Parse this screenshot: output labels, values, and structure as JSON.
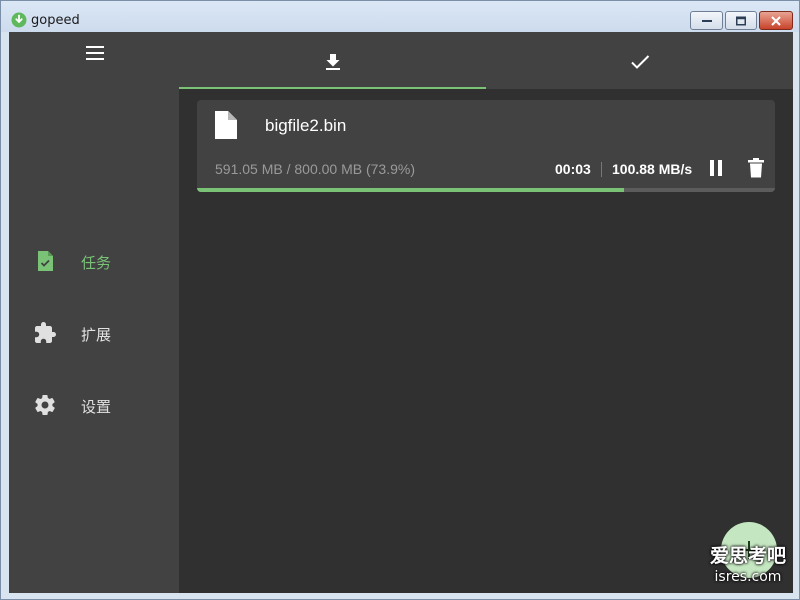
{
  "window": {
    "title": "gopeed",
    "controls": {
      "minimize": "minimize-icon",
      "maximize": "maximize-icon",
      "close": "close-icon"
    }
  },
  "sidebar": {
    "menu_icon": "menu-icon",
    "items": [
      {
        "id": "tasks",
        "label": "任务",
        "icon": "task-file-icon",
        "active": true
      },
      {
        "id": "extensions",
        "label": "扩展",
        "icon": "puzzle-icon",
        "active": false
      },
      {
        "id": "settings",
        "label": "设置",
        "icon": "gear-icon",
        "active": false
      }
    ]
  },
  "tabs": [
    {
      "id": "downloading",
      "icon": "download-icon",
      "active": true
    },
    {
      "id": "done",
      "icon": "check-icon",
      "active": false
    }
  ],
  "tasks": [
    {
      "file_name": "bigfile2.bin",
      "progress_text": "591.05 MB / 800.00 MB (73.9%)",
      "progress_fraction": 0.739,
      "elapsed": "00:03",
      "speed": "100.88 MB/s"
    }
  ],
  "fab": {
    "icon": "add-icon"
  },
  "watermark": {
    "line1": "爱思考吧",
    "line2": "isres.com"
  },
  "colors": {
    "accent": "#79c276",
    "background": "#303030",
    "surface": "#424242",
    "fab": "#c4e6c0"
  }
}
